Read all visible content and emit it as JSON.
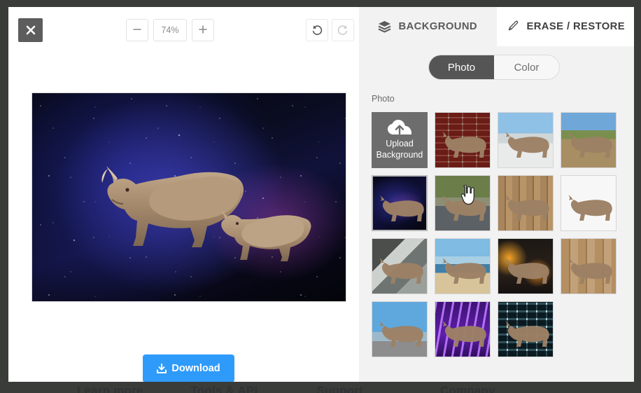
{
  "editor": {
    "close_label": "✕",
    "close_icon": "close-icon",
    "zoom_out_label": "−",
    "zoom_level": "74%",
    "zoom_in_label": "+",
    "undo_icon": "undo-arrow-icon",
    "redo_icon": "redo-arrow-icon",
    "download_label": "Download",
    "download_icon": "download-icon",
    "download_color": "#2e9bfb",
    "canvas_alt": "two rhinos on a starry galaxy background"
  },
  "side_panel": {
    "tabs": [
      {
        "label": "BACKGROUND",
        "icon": "layers-icon",
        "active": false
      },
      {
        "label": "ERASE / RESTORE",
        "icon": "brush-icon",
        "active": true
      }
    ],
    "mode_toggle": {
      "options": [
        {
          "label": "Photo",
          "selected": true
        },
        {
          "label": "Color",
          "selected": false
        }
      ]
    },
    "section_label": "Photo",
    "upload_tile": {
      "line1": "Upload",
      "line2": "Background",
      "icon": "cloud-upload-icon"
    },
    "thumbnails": [
      {
        "name": "brick-wall",
        "bg": "bg-brick",
        "selected": false
      },
      {
        "name": "snowy-city",
        "bg": "bg-snow",
        "selected": false
      },
      {
        "name": "green-field",
        "bg": "bg-field",
        "selected": false
      },
      {
        "name": "galaxy-space",
        "bg": "bg-space",
        "selected": true
      },
      {
        "name": "forest-road",
        "bg": "bg-road",
        "selected": false
      },
      {
        "name": "wood-carving",
        "bg": "bg-wood",
        "selected": false
      },
      {
        "name": "plain-white",
        "bg": "bg-white",
        "selected": false
      },
      {
        "name": "grey-tunnel",
        "bg": "bg-tunnel",
        "selected": false
      },
      {
        "name": "beach-shore",
        "bg": "bg-beach",
        "selected": false
      },
      {
        "name": "fire-night-city",
        "bg": "bg-fire",
        "selected": false
      },
      {
        "name": "wooden-planks",
        "bg": "bg-wood2",
        "selected": false
      },
      {
        "name": "blue-sky-city",
        "bg": "bg-city",
        "selected": false
      },
      {
        "name": "purple-stage-neon",
        "bg": "bg-neon",
        "selected": false
      },
      {
        "name": "glass-facade",
        "bg": "bg-glass",
        "selected": false
      }
    ],
    "scrollbar": {
      "up_arrow": "scroll-up-arrow",
      "down_arrow": "scroll-down-arrow"
    }
  },
  "cursor": {
    "type": "pointing-hand"
  },
  "footer": {
    "columns": [
      "Learn more",
      "Tools & API",
      "Support",
      "Company"
    ]
  }
}
